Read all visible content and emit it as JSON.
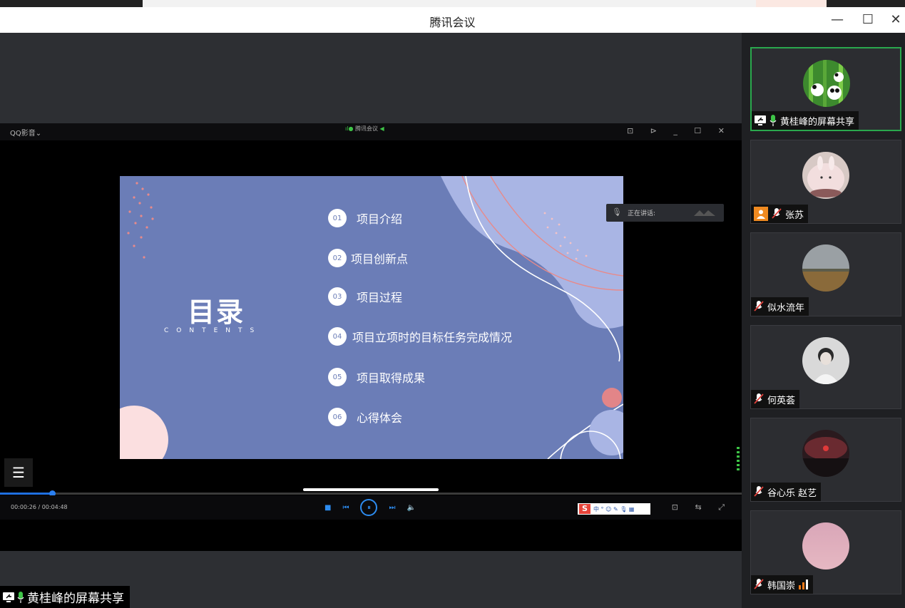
{
  "window": {
    "title": "腾讯会议",
    "minimize_symbol": "—",
    "maximize_symbol": "☐",
    "close_symbol": "✕"
  },
  "player": {
    "app_name": "QQ影音⌄",
    "meeting_tag": "腾讯会议",
    "time": "00:00:26 / 00:04:48",
    "progress": 0.07,
    "controls": [
      "■",
      "⏮",
      "⏸",
      "⏭",
      "🔈"
    ],
    "ime_label": "中 ° ☺ ✎ 🎙 ▦",
    "ime_logo": "S",
    "tools_top": "⊡ ⊳ _ ☐ ✕",
    "tools_bottom": "⊡ ⇆ ⤢"
  },
  "slide": {
    "title": "目录",
    "subtitle": "CONTENTS",
    "items": [
      {
        "num": "01",
        "label": "项目介绍"
      },
      {
        "num": "02",
        "label": "项目创新点"
      },
      {
        "num": "03",
        "label": "项目过程"
      },
      {
        "num": "04",
        "label": "项目立项时的目标任务完成情况"
      },
      {
        "num": "05",
        "label": "项目取得成果"
      },
      {
        "num": "06",
        "label": "心得体会"
      }
    ]
  },
  "speaking_tip": {
    "text": "正在讲话:"
  },
  "presenter": {
    "label": "黄桂峰的屏幕共享"
  },
  "participants": [
    {
      "name": "黄桂峰的屏幕共享",
      "avatar_icon": "panda-avatar",
      "accent": "#2aa84d"
    },
    {
      "name": "张苏",
      "avatar_icon": "bunny-cake-avatar",
      "accent": "#f08a20"
    },
    {
      "name": "似水流年",
      "avatar_icon": "landscape-avatar"
    },
    {
      "name": "何英荟",
      "avatar_icon": "portrait-avatar"
    },
    {
      "name": "谷心乐 赵艺",
      "avatar_icon": "red-sunset-avatar"
    },
    {
      "name": "韩国崇",
      "avatar_icon": "pink-sky-avatar",
      "signal_color": "#f07a1a"
    }
  ]
}
